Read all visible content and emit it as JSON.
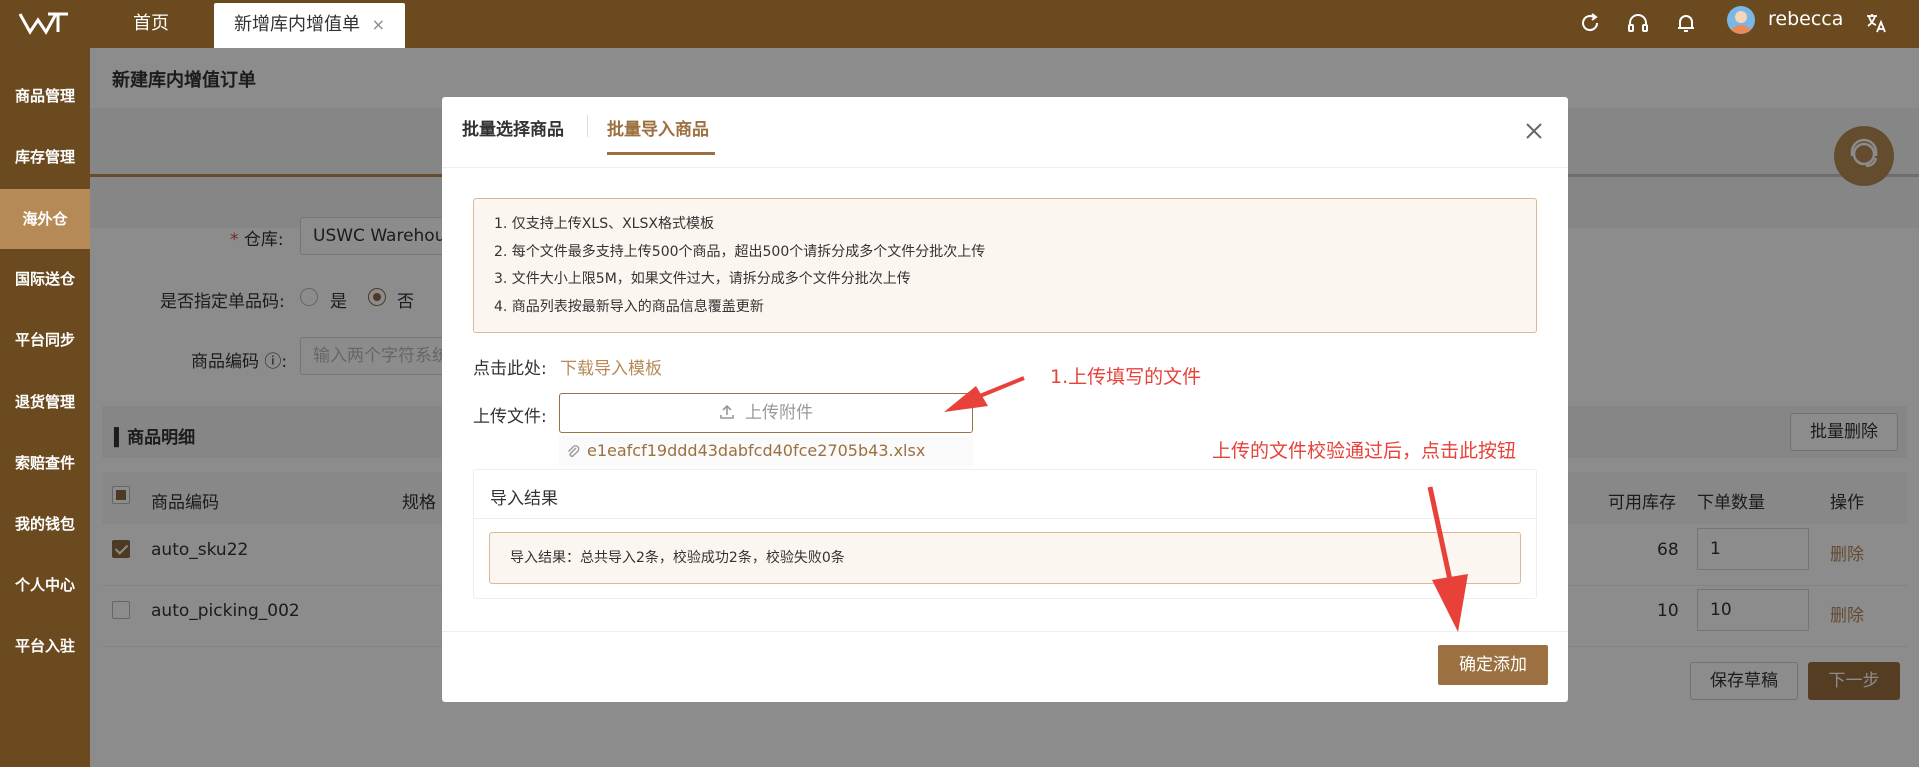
{
  "topbar": {
    "tabs": [
      {
        "label": "首页"
      },
      {
        "label": "新增库内增值单",
        "close": "×"
      }
    ],
    "username": "rebecca",
    "icons": [
      "refresh-icon",
      "headset-icon",
      "bell-icon",
      "translate-icon"
    ]
  },
  "sidebar": {
    "items": [
      {
        "label": "商品管理"
      },
      {
        "label": "库存管理"
      },
      {
        "label": "海外仓",
        "active": true
      },
      {
        "label": "国际送仓"
      },
      {
        "label": "平台同步"
      },
      {
        "label": "退货管理"
      },
      {
        "label": "索赔查件"
      },
      {
        "label": "我的钱包"
      },
      {
        "label": "个人中心"
      },
      {
        "label": "平台入驻"
      }
    ]
  },
  "page": {
    "title": "新建库内增值订单",
    "form": {
      "warehouse_label": "仓库:",
      "warehouse_required": "*",
      "warehouse_value": "USWC Warehouse",
      "single_code_label": "是否指定单品码:",
      "radio_yes": "是",
      "radio_no": "否",
      "radio_selected": "否",
      "product_code_label": "商品编码",
      "product_code_placeholder": "输入两个字符系统"
    },
    "detail": {
      "title": "商品明细",
      "batch_delete": "批量删除",
      "columns": [
        "商品编码",
        "规格",
        "可用库存",
        "下单数量",
        "操作"
      ],
      "rows": [
        {
          "sku": "auto_sku22",
          "stock": "68",
          "qty": "1",
          "action": "删除",
          "checked": true
        },
        {
          "sku": "auto_picking_002",
          "stock": "10",
          "qty": "10",
          "action": "删除",
          "checked": false
        }
      ],
      "save_draft": "保存草稿",
      "next_step": "下一步"
    }
  },
  "modal": {
    "tabs": [
      {
        "label": "批量选择商品"
      },
      {
        "label": "批量导入商品",
        "active": true
      }
    ],
    "notice": [
      "1. 仅支持上传XLS、XLSX格式模板",
      "2. 每个文件最多支持上传500个商品，超出500个请拆分成多个文件分批次上传",
      "3. 文件大小上限5M，如果文件过大，请拆分成多个文件分批次上传",
      "4. 商品列表按最新导入的商品信息覆盖更新"
    ],
    "template_label": "点击此处:",
    "template_link": "下载导入模板",
    "upload_label": "上传文件:",
    "upload_button": "上传附件",
    "file_name": "e1eafcf19ddd43dabfcd40fce2705b43.xlsx",
    "result_title": "导入结果",
    "result_text": "导入结果：总共导入2条，校验成功2条，校验失败0条",
    "confirm_button": "确定添加"
  },
  "annotations": {
    "upload_hint": "1.上传填写的文件",
    "confirm_hint": "上传的文件校验通过后，点击此按钮"
  },
  "colors": {
    "brand": "#6b4a1f",
    "accent": "#9c7040",
    "sidebar_active": "#b68a57",
    "annotation": "#e8413a"
  }
}
